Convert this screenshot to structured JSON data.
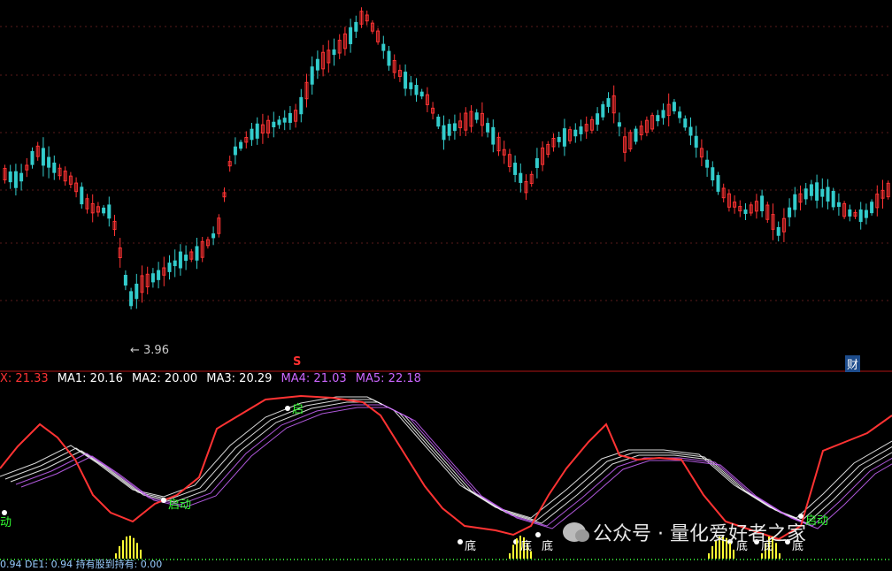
{
  "chart_data": {
    "type": "candlestick",
    "low_marker": "3.96",
    "event_marker": "S",
    "finance_marker": "财",
    "indicator_line": [
      {
        "label": "X: 21.33",
        "color": "#ff3333"
      },
      {
        "label": "MA1: 20.16",
        "color": "#ffffff"
      },
      {
        "label": "MA2: 20.00",
        "color": "#ffffff"
      },
      {
        "label": "MA3: 20.29",
        "color": "#ffffff"
      },
      {
        "label": "MA4: 21.03",
        "color": "#cc66ff"
      },
      {
        "label": "MA5: 22.18",
        "color": "#cc66ff"
      }
    ],
    "signals": [
      {
        "text": "动",
        "kind": "start"
      },
      {
        "text": "启动",
        "kind": "start"
      },
      {
        "text": "启",
        "kind": "start"
      },
      {
        "text": "底",
        "kind": "bottom"
      },
      {
        "text": "底",
        "kind": "bottom"
      },
      {
        "text": "底",
        "kind": "bottom"
      },
      {
        "text": "启动",
        "kind": "start"
      },
      {
        "text": "底",
        "kind": "bottom"
      },
      {
        "text": "底",
        "kind": "bottom"
      },
      {
        "text": "底",
        "kind": "bottom"
      }
    ],
    "bottom_text": "0.94 DE1: 0.94 持有股到持有: 0.00",
    "colors": {
      "up": "#ff3333",
      "down": "#33cccc",
      "ma_light": "#ffffff",
      "ma_dark": "#cc66ff",
      "signal": "#33ff33"
    }
  },
  "watermark": "公众号 · 量化爱好者之家"
}
